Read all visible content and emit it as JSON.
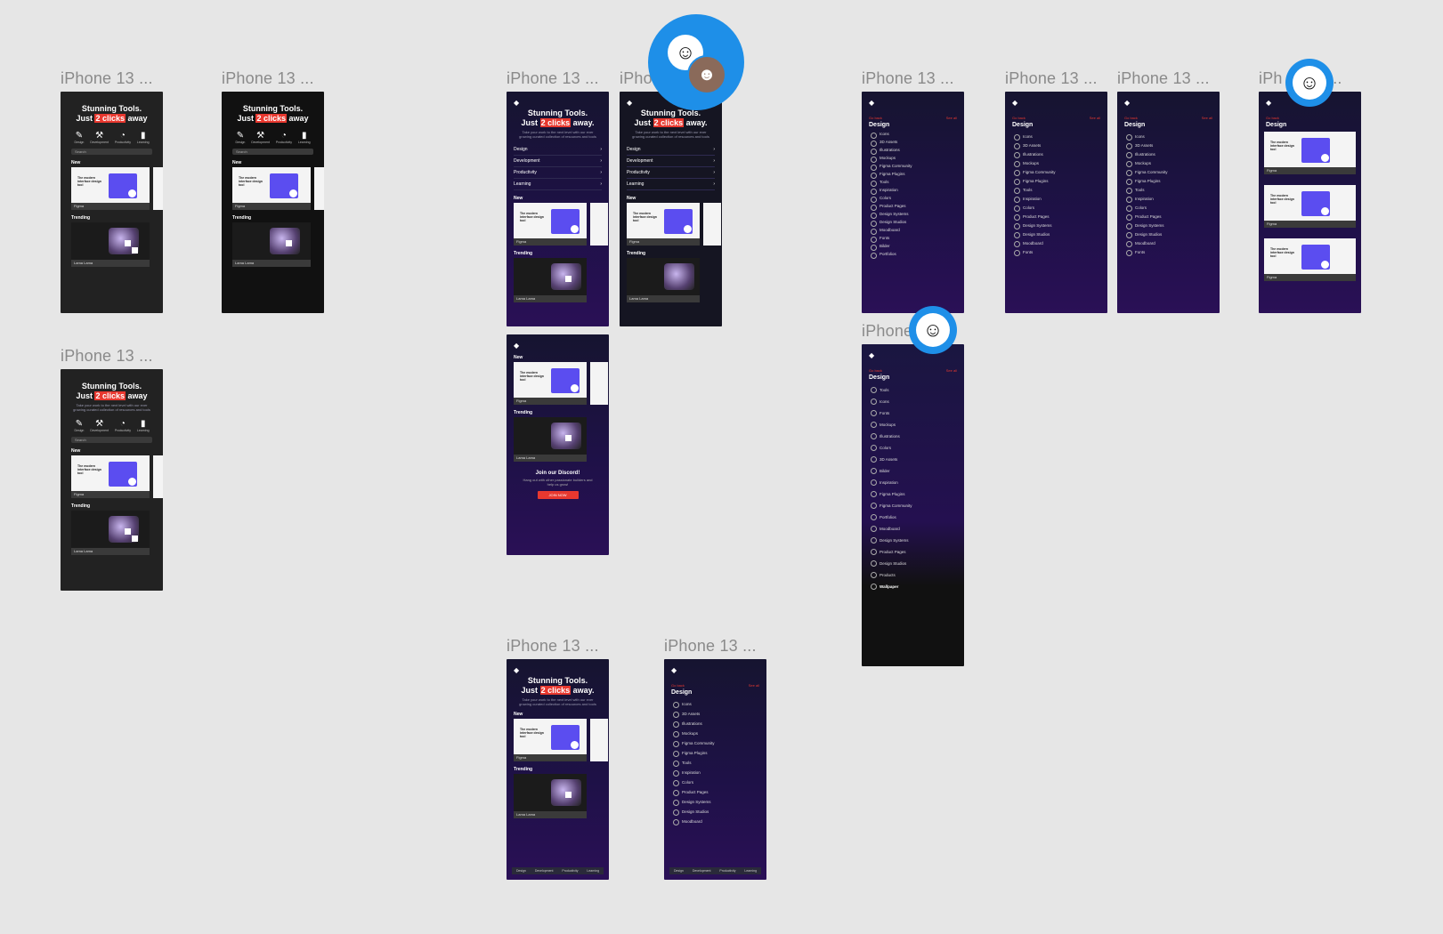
{
  "frame_label": "iPhone 13 ...",
  "short_label": "iPho",
  "iphone_label": "iPhone",
  "iphe_label": "iPh",
  "ellipsis": "...",
  "hero": {
    "line1": "Stunning Tools.",
    "just": "Just ",
    "clicks": "2 clicks",
    "away": " away",
    "away_dot": " away.",
    "sub": "Take your work to the next level with our ever growing curated collection of resources and tools"
  },
  "icon_labels": [
    "Design",
    "Development",
    "Productivity",
    "Learning"
  ],
  "search_placeholder": "Search",
  "sections": {
    "new": "New",
    "trending": "Trending"
  },
  "cards": {
    "title": "The modern interface design tool",
    "figma": "Figma",
    "lama": "Lama Lama"
  },
  "nav": [
    "Design",
    "Development",
    "Productivity",
    "Learning"
  ],
  "design": {
    "back": "Go back",
    "see_all": "See all",
    "title": "Design"
  },
  "list_a": [
    "Icons",
    "3D Assets",
    "Illustrations",
    "Mockups",
    "Figma Community",
    "Figma Plugins",
    "Tools",
    "Inspiration",
    "Colors",
    "Product Pages",
    "Design Systems",
    "Design Studios",
    "Moodboard",
    "Fonts",
    "Bilder",
    "Portfolios"
  ],
  "list_b": [
    "Tools",
    "Icons",
    "Fonts",
    "Mockups",
    "Illustrations",
    "Colors",
    "3D Assets",
    "Bilder",
    "Inspiration",
    "Figma Plugins",
    "Figma Community",
    "Portfolios",
    "Moodboard",
    "Design Systems",
    "Product Pages",
    "Design Studios",
    "Products",
    "Wallpaper"
  ],
  "discord": {
    "title": "Join our Discord!",
    "sub": "Hang out with other passionate builders and help us grow!",
    "button": "JOIN NOW"
  },
  "colors": {
    "canvas": "#e6e6e6",
    "accent": "#e8382f",
    "avatar": "#1e8fe8",
    "brand_purple": "#5b4df0"
  }
}
